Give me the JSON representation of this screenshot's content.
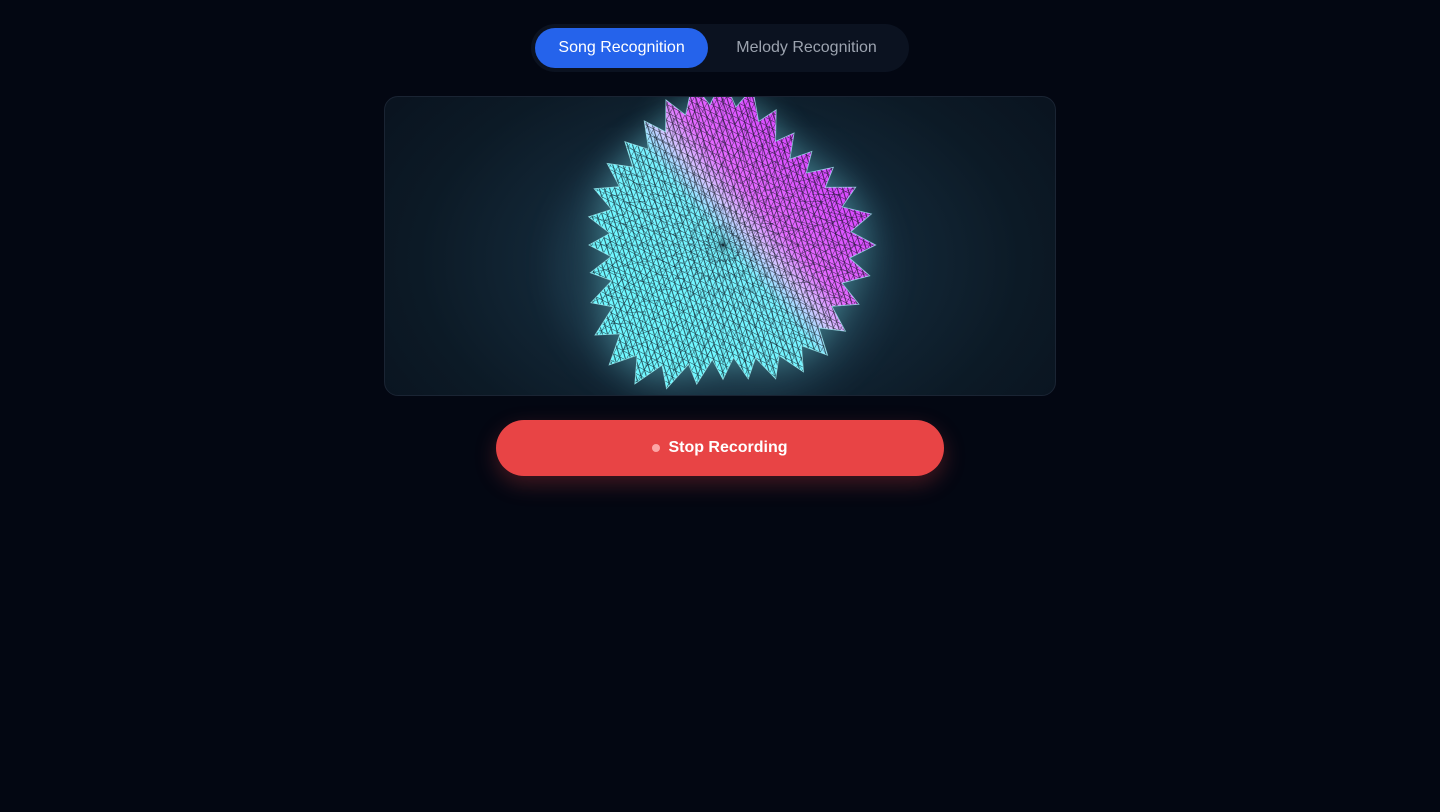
{
  "tabs": [
    {
      "label": "Song Recognition",
      "active": true
    },
    {
      "label": "Melody Recognition",
      "active": false
    }
  ],
  "visualizer": {
    "icon": "wireframe-sphere-visualizer",
    "colors": {
      "cyan": "#6ff7ff",
      "magenta": "#e35cff",
      "panel_glow": "#1e3f4d"
    }
  },
  "record_button": {
    "label": "Stop Recording",
    "state": "recording",
    "icon": "recording-dot-icon",
    "color": "#e84445"
  },
  "theme": {
    "background": "#030712",
    "accent": "#2563eb"
  }
}
